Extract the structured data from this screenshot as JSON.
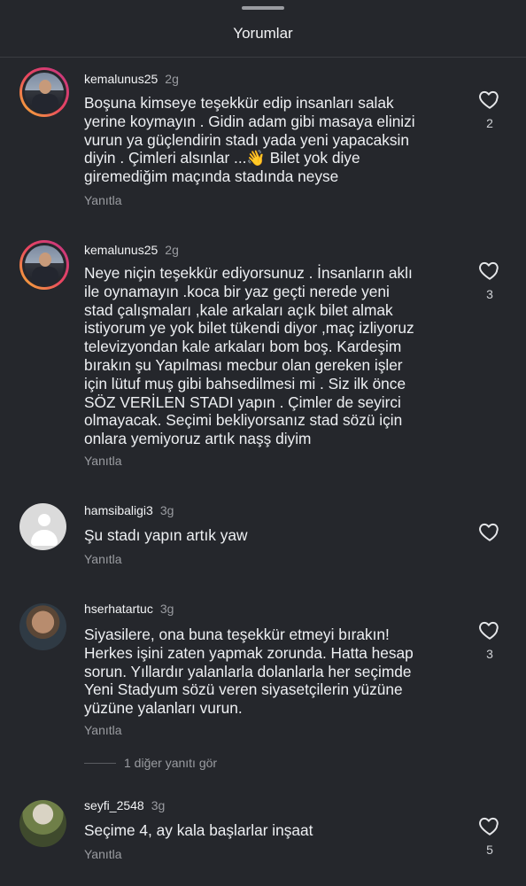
{
  "header": {
    "title": "Yorumlar"
  },
  "comments": [
    {
      "username": "kemalunus25",
      "time": "2g",
      "text": "Boşuna kimseye teşekkür edip insanları salak\nyerine koymayın . Gidin adam gibi masaya elinizi\nvurun ya  güçlendirin stadı yada yeni yapacaksin\ndiyin . Çimleri alsınlar ...👋 Bilet yok diye\ngiremediğim maçında  stadında neyse",
      "reply": "Yanıtla",
      "likes": "2"
    },
    {
      "username": "kemalunus25",
      "time": "2g",
      "text": "Neye niçin teşekkür ediyorsunuz . İnsanların aklı\nile oynamayın .koca bir yaz geçti nerede  yeni\nstad çalışmaları ,kale arkaları açık bilet almak\nistiyorum ye yok bilet tükendi diyor ,maç izliyoruz\ntelevizyondan kale arkaları bom boş. Kardeşim\nbırakın şu Yapılması mecbur olan gereken işler\niçin lütuf muş gibi bahsedilmesi mi . Siz ilk önce\nSÖZ VERİLEN STADI yapın . Çimler de seyirci\nolmayacak. Seçimi bekliyorsanız stad sözü için\nonlara yemiyoruz artık naşş diyim",
      "reply": "Yanıtla",
      "likes": "3"
    },
    {
      "username": "hamsibaligi3",
      "time": "3g",
      "text": "Şu stadı yapın artık yaw",
      "reply": "Yanıtla",
      "likes": ""
    },
    {
      "username": "hserhatartuc",
      "time": "3g",
      "text": "Siyasilere, ona buna teşekkür etmeyi bırakın!\nHerkes işini zaten yapmak zorunda. Hatta hesap\nsorun. Yıllardır yalanlarla dolanlarla her seçimde\nYeni Stadyum sözü veren siyasetçilerin yüzüne\nyüzüne yalanları vurun.",
      "reply": "Yanıtla",
      "likes": "3",
      "more_replies": "1 diğer yanıtı gör"
    },
    {
      "username": "seyfi_2548",
      "time": "3g",
      "text": "Seçime 4, ay kala başlarlar inşaat",
      "reply": "Yanıtla",
      "likes": "5"
    }
  ],
  "icons": {
    "like": "heart-outline-icon"
  }
}
